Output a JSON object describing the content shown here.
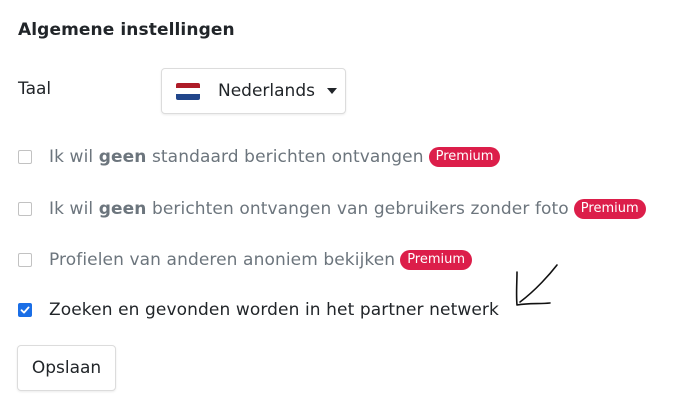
{
  "section": {
    "title": "Algemene instellingen"
  },
  "language": {
    "label": "Taal",
    "selected": "Nederlands",
    "flag_colors": [
      "#ae1c28",
      "#ffffff",
      "#21468b"
    ]
  },
  "options": [
    {
      "prefix": "Ik wil ",
      "bold": "geen",
      "suffix": " standaard berichten ontvangen",
      "badge": "Premium",
      "checked": false
    },
    {
      "prefix": "Ik wil ",
      "bold": "geen",
      "suffix": " berichten ontvangen van gebruikers zonder foto",
      "badge": "Premium",
      "checked": false
    },
    {
      "text": "Profielen van anderen anoniem bekijken",
      "badge": "Premium",
      "checked": false
    },
    {
      "text": "Zoeken en gevonden worden in het partner netwerk",
      "checked": true
    }
  ],
  "save_button": {
    "label": "Opslaan"
  },
  "colors": {
    "badge": "#dc1e4a",
    "checkbox_checked": "#1a6ee6"
  },
  "annotation": {
    "icon": "hand-drawn-arrow-icon"
  }
}
